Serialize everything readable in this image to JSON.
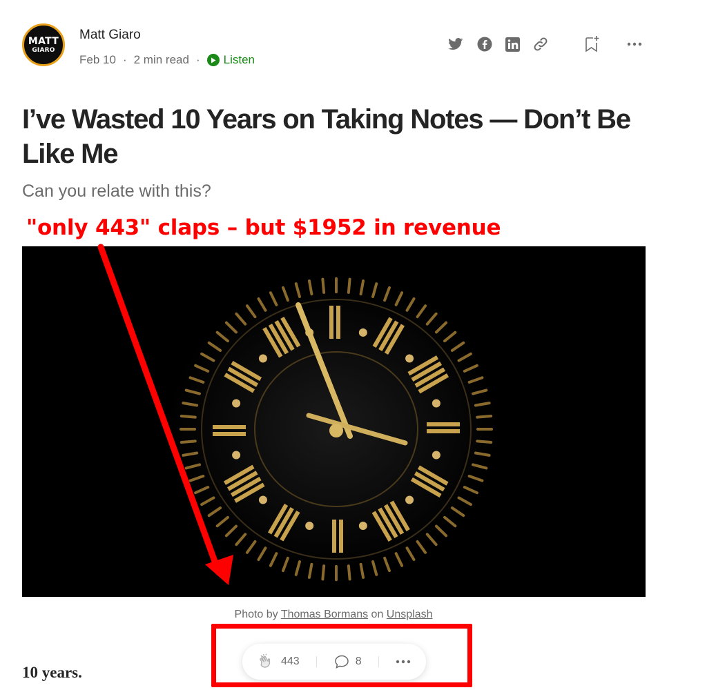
{
  "author": {
    "name": "Matt Giaro",
    "avatar_line1": "MATT",
    "avatar_line2": "GIARO",
    "date": "Feb 10",
    "read_time": "2 min read",
    "separator": "·",
    "listen_label": "Listen"
  },
  "share_icons": [
    "twitter-icon",
    "facebook-icon",
    "linkedin-icon",
    "link-icon",
    "bookmark-add-icon",
    "more-icon"
  ],
  "article": {
    "title": "I’ve Wasted 10 Years on Taking Notes — Don’t Be Like Me",
    "subtitle": "Can you relate with this?",
    "first_paragraph": "10 years."
  },
  "annotation": {
    "text": "\"only 443\" claps – but $1952 in revenue",
    "color": "#ff0000"
  },
  "caption": {
    "prefix": "Photo by ",
    "photographer": "Thomas Bormans",
    "middle": " on ",
    "source": "Unsplash"
  },
  "actions": {
    "claps": "443",
    "responses": "8"
  },
  "colors": {
    "text": "#242424",
    "muted": "#6b6b6b",
    "listen_green": "#1a8917",
    "annotation_red": "#ff0000",
    "clock_gold": "#c9a24e"
  }
}
